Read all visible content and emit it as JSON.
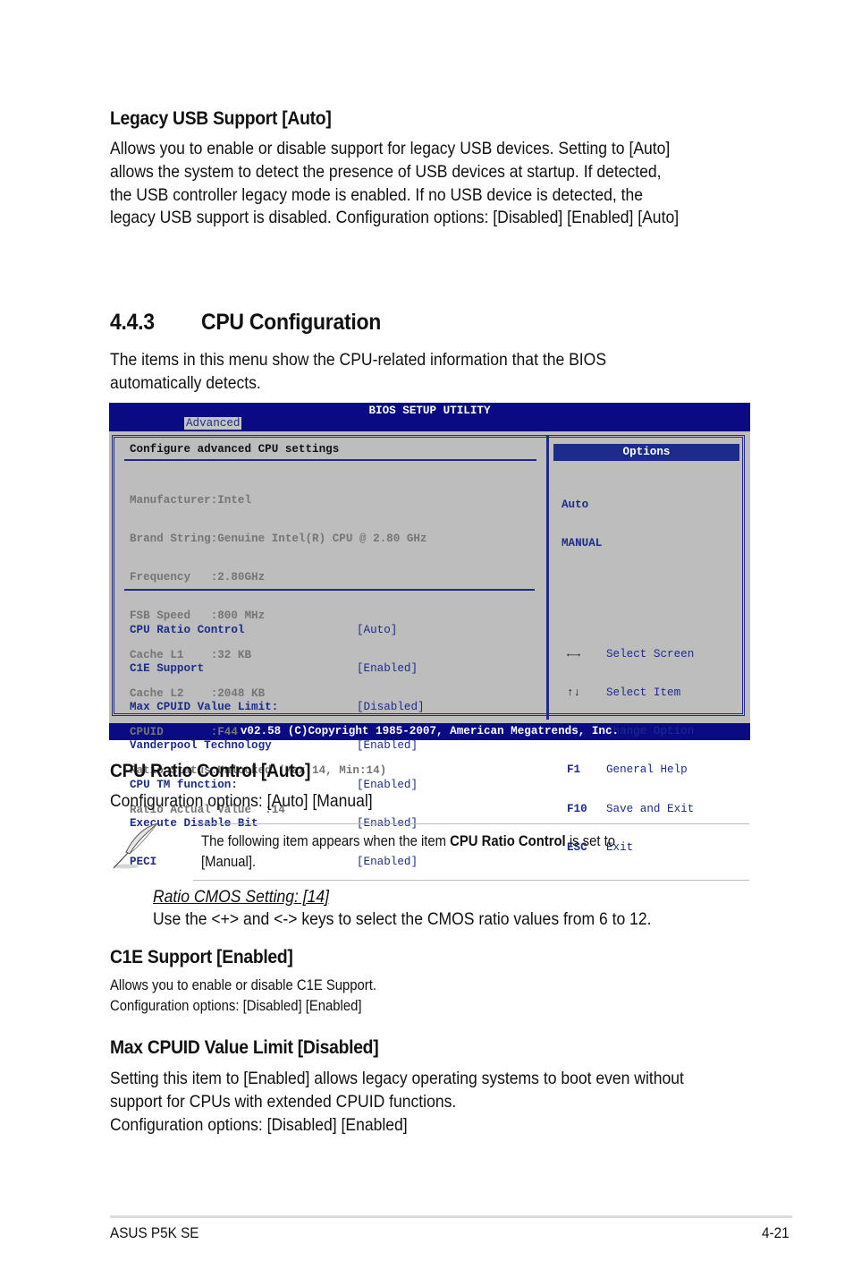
{
  "legacy_usb": {
    "heading": "Legacy USB Support [Auto]",
    "lines": [
      "Allows you to enable or disable support for legacy USB devices. Setting to [Auto]",
      "allows the system to detect the presence of USB devices at startup. If detected,",
      "the USB controller legacy mode is enabled. If no USB device is detected, the",
      "legacy USB support is disabled. Configuration options: [Disabled] [Enabled] [Auto]"
    ]
  },
  "section": {
    "number": "4.4.3",
    "title": "CPU Configuration",
    "intro_lines": [
      "The items in this menu show the CPU-related information that the BIOS",
      "automatically detects."
    ]
  },
  "bios": {
    "title": "BIOS SETUP UTILITY",
    "active_tab": "Advanced",
    "panel_title": "Configure advanced CPU settings",
    "info": [
      "Manufacturer:Intel",
      "Brand String:Genuine Intel(R) CPU @ 2.80 GHz",
      "Frequency   :2.80GHz",
      "FSB Speed   :800 MHz",
      "Cache L1    :32 KB",
      "Cache L2    :2048 KB",
      "CPUID       :F44",
      "Ratio Status:Unlocked (Max:14, Min:14)",
      "Ratio Actual Value  :14"
    ],
    "settings": [
      {
        "label": "CPU Ratio Control",
        "value": "[Auto]"
      },
      {
        "label": "C1E Support",
        "value": "[Enabled]"
      },
      {
        "label": "Max CPUID Value Limit:",
        "value": "[Disabled]"
      },
      {
        "label": "Vanderpool Technology",
        "value": "[Enabled]"
      },
      {
        "label": "CPU TM function:",
        "value": "[Enabled]"
      },
      {
        "label": "Execute Disable Bit",
        "value": "[Enabled]"
      },
      {
        "label": "PECI",
        "value": "[Enabled]"
      }
    ],
    "options_header": "Options",
    "options": [
      "Auto",
      "MANUAL"
    ],
    "keys": [
      {
        "key": "←→",
        "icon": "left-right-arrows-icon",
        "action": "Select Screen"
      },
      {
        "key": "↑↓",
        "icon": "up-down-arrows-icon",
        "action": "Select Item"
      },
      {
        "key": "+-",
        "action": "Change Option"
      },
      {
        "key": "F1",
        "action": "General Help"
      },
      {
        "key": "F10",
        "action": "Save and Exit"
      },
      {
        "key": "ESC",
        "action": "Exit"
      }
    ],
    "footer": "v02.58 (C)Copyright 1985-2007, American Megatrends, Inc.",
    "colors": {
      "frame": "#0a0a84",
      "accent": "#1d2c8a",
      "panel": "#bdbdbd",
      "info_text": "#757575"
    }
  },
  "cpu_ratio": {
    "heading": "CPU Ratio Control [Auto]",
    "options": "Configuration options: [Auto] [Manual]",
    "note_pre": "The following item appears when the item ",
    "note_bold": "CPU Ratio Control",
    "note_post": " is set to",
    "note_line2": "[Manual].",
    "sub_heading": "Ratio CMOS Setting: [14]",
    "sub_text": "Use the <+> and <-> keys to select the CMOS ratio values from 6 to 12."
  },
  "c1e": {
    "heading": "C1E Support [Enabled]",
    "lines": [
      "Allows you to enable or disable C1E Support.",
      "Configuration options: [Disabled] [Enabled]"
    ]
  },
  "max_cpuid": {
    "heading": "Max CPUID Value Limit [Disabled]",
    "lines": [
      "Setting this item to [Enabled] allows legacy operating systems to boot even without",
      "support for CPUs with extended CPUID functions.",
      "Configuration options: [Disabled] [Enabled]"
    ]
  },
  "footer": {
    "product": "ASUS P5K SE",
    "page": "4-21"
  }
}
